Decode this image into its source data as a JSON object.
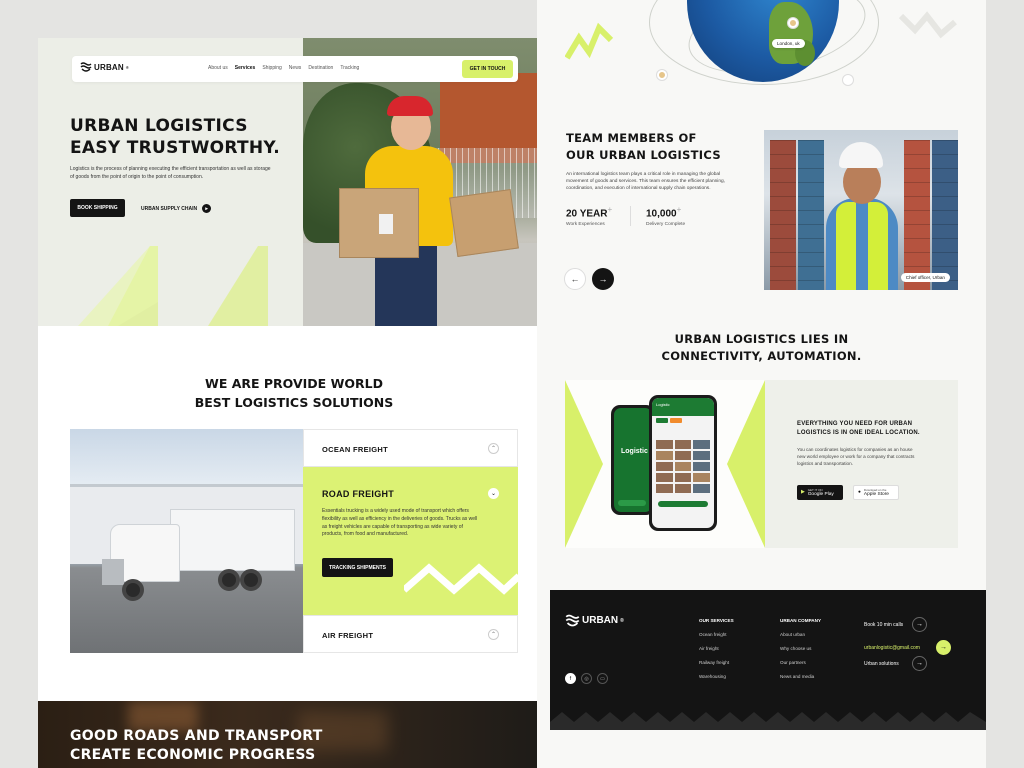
{
  "brand": {
    "name": "URBAN",
    "accent": "#d8f06a",
    "dark": "#141414",
    "logo_icon": "wave-logo-icon"
  },
  "nav": {
    "links": [
      "About us",
      "Services",
      "Shipping",
      "News",
      "Destination",
      "Tracking"
    ],
    "active": "Services",
    "cta": "GET IN TOUCH"
  },
  "hero": {
    "title_line1": "URBAN LOGISTICS",
    "title_line2": "EASY TRUSTWORTHY.",
    "description": "Logistics is the process of planning executing the efficient transportation as well as storage of goods from the point of origin to the point of consumption.",
    "primary_button": "BOOK SHIPPING",
    "secondary_link": "URBAN SUPPLY CHAIN"
  },
  "solutions": {
    "title_line1": "WE ARE PROVIDE WORLD",
    "title_line2": "BEST LOGISTICS SOLUTIONS",
    "items": [
      {
        "title": "OCEAN FREIGHT",
        "expanded": false
      },
      {
        "title": "ROAD FREIGHT",
        "expanded": true,
        "body": "Essentials trucking is a widely used mode of transport which offers flexibility as well as efficiency in the deliveries of goods. Trucks as well as freight vehicles are capable of transporting as wide variety of products, from food and manufactured.",
        "button": "TRACKING SHIPMENTS"
      },
      {
        "title": "AIR FREIGHT",
        "expanded": false
      }
    ]
  },
  "banner": {
    "title_line1": "GOOD ROADS AND TRANSPORT",
    "title_line2": "CREATE ECONOMIC PROGRESS"
  },
  "globe": {
    "location_label": "London, uk"
  },
  "team": {
    "title_line1": "TEAM MEMBERS OF",
    "title_line2": "OUR URBAN LOGISTICS",
    "description": "An international logistics team plays a critical role in managing the global movement of goods and services. This team ensures the efficient planning, coordination, and execution of international supply chain operations.",
    "stats": [
      {
        "value": "20 YEAR",
        "suffix": "+",
        "label": "Work Experiences"
      },
      {
        "value": "10,000",
        "suffix": "+",
        "label": "Delivery Complete"
      }
    ],
    "photo_caption": "Chief officer, Urban",
    "prev_icon": "←",
    "next_icon": "→"
  },
  "connectivity": {
    "title_line1": "URBAN LOGISTICS LIES IN",
    "title_line2": "CONNECTIVITY, AUTOMATION.",
    "promo_title": "EVERYTHING YOU NEED FOR URBAN LOGISTICS IS IN ONE IDEAL LOCATION.",
    "promo_desc": "You can coordinates logistics for companies as an house new world employee or work for a company that contracts logistics and transportation.",
    "app_name": "Logistic",
    "app_name_small": "Logistic",
    "stores": [
      {
        "small": "GET IT ON",
        "name": "Google Play"
      },
      {
        "small": "Download on the",
        "name": "Apple Store"
      }
    ]
  },
  "footer": {
    "services_heading": "OUR SERVICES",
    "services": [
      "Ocean freight",
      "Air freight",
      "Railway freight",
      "Warehousing"
    ],
    "company_heading": "URBAN COMPANY",
    "company": [
      "About urban",
      "Why choose us",
      "Our partners",
      "News and media"
    ],
    "cta_calls": "Book 10 min calls",
    "email": "urbanlogistic@gmail.com",
    "solutions": "Urban solutions",
    "social_icons": [
      "facebook-icon",
      "instagram-icon",
      "twitter-icon"
    ]
  }
}
